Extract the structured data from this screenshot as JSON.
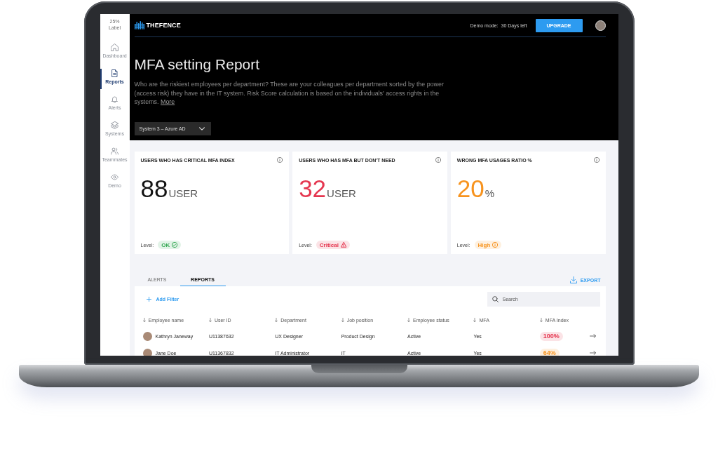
{
  "sidebar": {
    "stat": {
      "value": "25%",
      "label": "Label"
    },
    "items": [
      {
        "label": "Dashboard",
        "selected": false
      },
      {
        "label": "Reports",
        "selected": true
      },
      {
        "label": "Alerts",
        "selected": false
      },
      {
        "label": "Systems",
        "selected": false
      },
      {
        "label": "Teammates",
        "selected": false
      },
      {
        "label": "Demo",
        "selected": false
      }
    ]
  },
  "header": {
    "logo": "THEFENCE",
    "demo_label": "Demo mode:",
    "demo_value": "30 Days left",
    "upgrade_button": "UPGRADE"
  },
  "report": {
    "title": "MFA setting Report",
    "description": "Who are the riskiest employees per department? These are your colleagues per department sorted by the power (access risk) they have in the IT system. Risk Score calculation is based on the individuals' access rights in the systems.",
    "more_link": "More",
    "system_select": "System 3 – Azure AD"
  },
  "cards": [
    {
      "title": "USERS WHO HAS CRITICAL MFA INDEX",
      "value": "88",
      "unit": "USER",
      "level_label": "Level:",
      "badge": "OK",
      "kind": "ok",
      "color": "#34a853"
    },
    {
      "title": "USERS WHO HAS MFA BUT DON'T NEED",
      "value": "32",
      "unit": "USER",
      "level_label": "Level:",
      "badge": "Critical",
      "kind": "critical",
      "color": "#e5364f"
    },
    {
      "title": "WRONG MFA USAGES RATIO %",
      "value": "20",
      "unit": "%",
      "level_label": "Level:",
      "badge": "High",
      "kind": "high",
      "color": "#f7931e"
    }
  ],
  "tabs": [
    {
      "label": "ALERTS",
      "selected": false
    },
    {
      "label": "REPORTS",
      "selected": true
    }
  ],
  "export_button": "EXPORT",
  "table": {
    "add_filter": "Add Filter",
    "search": {
      "placeholder": "Search"
    },
    "columns": [
      "Employee name",
      "User ID",
      "Department",
      "Job position",
      "Employee status",
      "MFA",
      "MFA Index"
    ],
    "rows": [
      {
        "employee_name": "Kathryn Janeway",
        "user_id": "U11387632",
        "department": "UX Designer",
        "job_position": "Product Design",
        "employee_status": "Active",
        "mfa": "Yes",
        "mfa_index": "100%",
        "color": "#e5364f"
      },
      {
        "employee_name": "Jane Doe",
        "user_id": "U11367832",
        "department": "IT Administrator",
        "job_position": "IT",
        "employee_status": "Active",
        "mfa": "Yes",
        "mfa_index": "64%",
        "color": "#f7931e"
      }
    ]
  }
}
